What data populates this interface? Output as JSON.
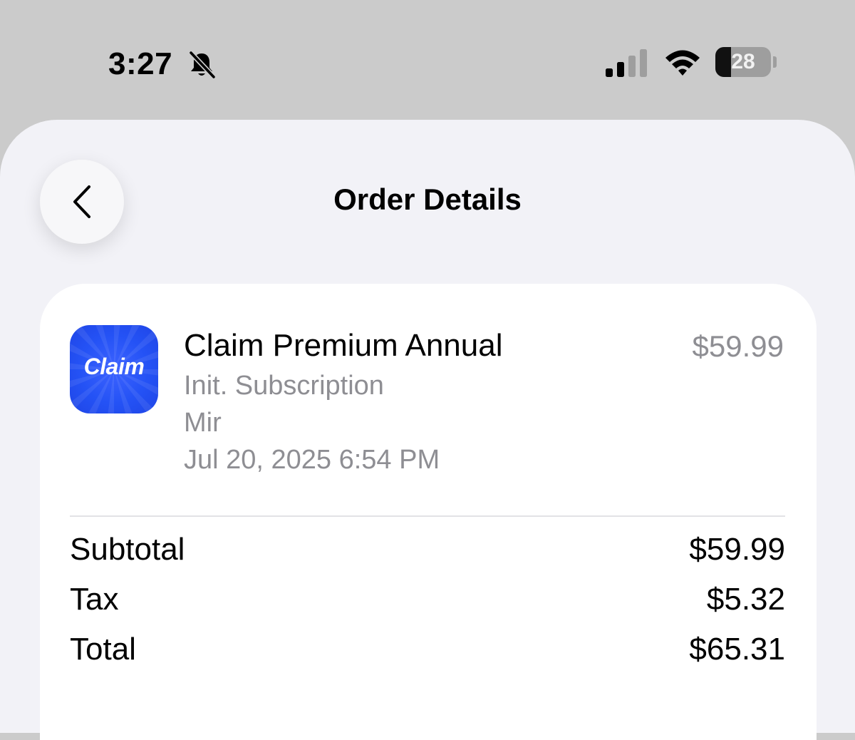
{
  "status_bar": {
    "time": "3:27",
    "battery_level": "28",
    "battery_fraction": 0.28,
    "signal_bars_filled": 2,
    "signal_bars_total": 4,
    "icons": [
      "bell-slash-icon",
      "cellular-signal-icon",
      "wifi-icon",
      "battery-icon"
    ]
  },
  "header": {
    "title": "Order Details",
    "back_icon": "chevron-left-icon"
  },
  "order_item": {
    "app_icon_text": "Claim",
    "app_icon_color": "#2452f5",
    "name": "Claim Premium Annual",
    "type": "Init. Subscription",
    "buyer": "Mir",
    "date": "Jul 20, 2025 6:54 PM",
    "price": "$59.99"
  },
  "summary": {
    "rows": [
      {
        "label": "Subtotal",
        "value": "$59.99"
      },
      {
        "label": "Tax",
        "value": "$5.32"
      },
      {
        "label": "Total",
        "value": "$65.31"
      }
    ]
  }
}
